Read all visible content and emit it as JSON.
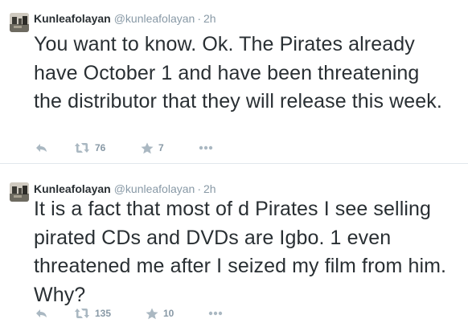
{
  "tweets": [
    {
      "fullname": "Kunleafolayan",
      "username": "@kunleafolayan",
      "separator": "·",
      "time": "2h",
      "text": "You want to know. Ok. The Pirates already have October 1 and have been threatening the distributor that they will release this week.",
      "retweets": "76",
      "favorites": "7"
    },
    {
      "fullname": "Kunleafolayan",
      "username": "@kunleafolayan",
      "separator": "·",
      "time": "2h",
      "text": "It is a fact that most of d Pirates I see selling pirated CDs and DVDs are Igbo. 1 even threatened me after I seized my film from him. Why?",
      "retweets": "135",
      "favorites": "10"
    }
  ],
  "icons": {
    "reply": "reply-icon",
    "retweet": "retweet-icon",
    "favorite": "star-icon",
    "more": "more-icon"
  },
  "colors": {
    "text": "#292f33",
    "muted": "#8899a6",
    "divider": "#e1e8ed"
  }
}
